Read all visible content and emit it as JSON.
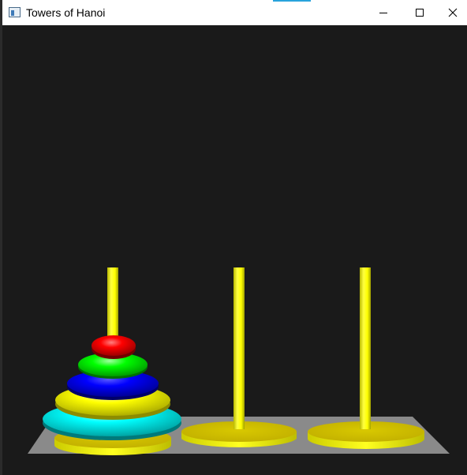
{
  "window": {
    "title": "Towers of Hanoi",
    "icon": "app-window-icon",
    "controls": [
      "minimize-icon",
      "maximize-icon",
      "close-icon"
    ]
  },
  "game": {
    "pegs": 3,
    "disks": 5,
    "state": [
      [
        "cyan",
        "yellow",
        "blue",
        "green",
        "red"
      ],
      [],
      []
    ],
    "colors": {
      "background": "#1a1a1a",
      "board": "#8a8a8a",
      "peg": "#ffff00",
      "base": "#e5d500",
      "disk_red": "#ff0000",
      "disk_green": "#00ff00",
      "disk_blue": "#0000ff",
      "disk_yellow": "#ffff00",
      "disk_cyan": "#00ffff"
    }
  }
}
